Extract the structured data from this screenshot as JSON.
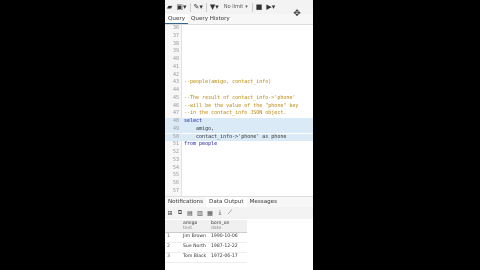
{
  "toolbar": {
    "limit_label": "No limit"
  },
  "tabs": [
    "Query",
    "Query History"
  ],
  "editor": {
    "lines": [
      {
        "n": "36",
        "text": "",
        "type": "plain"
      },
      {
        "n": "37",
        "text": "",
        "type": "plain"
      },
      {
        "n": "38",
        "text": "",
        "type": "plain"
      },
      {
        "n": "39",
        "text": "",
        "type": "plain"
      },
      {
        "n": "40",
        "text": "",
        "type": "plain"
      },
      {
        "n": "41",
        "text": "",
        "type": "plain"
      },
      {
        "n": "42",
        "text": "",
        "type": "plain"
      },
      {
        "n": "43",
        "text": "--people(amigo, contact_info)",
        "type": "comment"
      },
      {
        "n": "44",
        "text": "",
        "type": "plain"
      },
      {
        "n": "45",
        "text": "--The result of contact_info->'phone'",
        "type": "comment"
      },
      {
        "n": "46",
        "text": "--will be the value of the \"phone\" key",
        "type": "comment"
      },
      {
        "n": "47",
        "text": "--in the contact_info JSON object.",
        "type": "comment"
      },
      {
        "n": "48",
        "text": "select",
        "type": "keyword",
        "selected": true
      },
      {
        "n": "49",
        "text": "    amigo,",
        "type": "plain",
        "selected": true
      },
      {
        "n": "50",
        "text": "    contact_info->'phone' as phone",
        "type": "plain",
        "selected": true
      },
      {
        "n": "51",
        "text": "from people",
        "type": "keyword"
      },
      {
        "n": "52",
        "text": "",
        "type": "plain"
      },
      {
        "n": "53",
        "text": "",
        "type": "plain"
      },
      {
        "n": "54",
        "text": "",
        "type": "plain"
      },
      {
        "n": "55",
        "text": "",
        "type": "plain"
      },
      {
        "n": "56",
        "text": "",
        "type": "plain"
      },
      {
        "n": "57",
        "text": "",
        "type": "plain"
      }
    ]
  },
  "panel_tabs": [
    "Notifications",
    "Data Output",
    "Messages"
  ],
  "grid": {
    "columns": [
      {
        "name": "amigo",
        "type": "text"
      },
      {
        "name": "born_on",
        "type": "date"
      }
    ],
    "rows": [
      {
        "n": "1",
        "amigo": "Jim Brown",
        "born_on": "1990-10-06"
      },
      {
        "n": "2",
        "amigo": "Sue North",
        "born_on": "1987-12-22"
      },
      {
        "n": "3",
        "amigo": "Tom Black",
        "born_on": "1972-06-17"
      }
    ]
  }
}
